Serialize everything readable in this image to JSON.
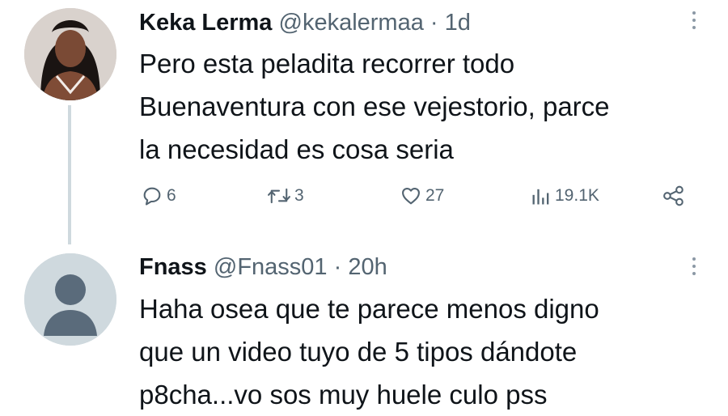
{
  "tweets": [
    {
      "author_name": "Keka Lerma",
      "handle": "@kekalermaa",
      "separator": "·",
      "time": "1d",
      "text_lines": [
        "Pero esta peladita recorrer todo",
        "Buenaventura con ese vejestorio, parce",
        "la necesidad es cosa seria"
      ],
      "metrics": {
        "replies": "6",
        "retweets": "3",
        "likes": "27",
        "views": "19.1K"
      }
    },
    {
      "author_name": "Fnass",
      "handle": "@Fnass01",
      "separator": "·",
      "time": "20h",
      "text_lines": [
        "Haha osea que te parece menos digno",
        "que un video tuyo de 5 tipos dándote",
        "p8cha...vo sos muy huele culo  pss"
      ]
    }
  ],
  "icons": {
    "reply": "reply-icon",
    "retweet": "retweet-icon",
    "like": "heart-icon",
    "views": "views-icon",
    "share": "share-icon",
    "more": "more-icon"
  },
  "colors": {
    "text": "#0f1419",
    "secondary": "#536471",
    "thread_line": "#cfd9de",
    "default_avatar_bg": "#cfd9de",
    "default_avatar_fg": "#5a6b7b"
  }
}
